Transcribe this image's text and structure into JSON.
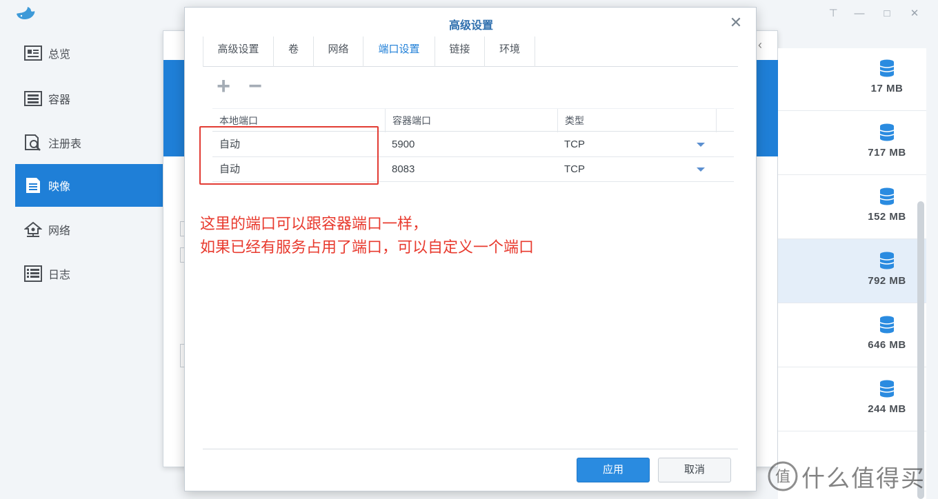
{
  "window": {
    "controls": [
      "pin-icon",
      "minimize-icon",
      "maximize-icon",
      "close-icon"
    ]
  },
  "sidebar": {
    "items": [
      {
        "label": "总览",
        "icon": "overview-icon"
      },
      {
        "label": "容器",
        "icon": "container-icon"
      },
      {
        "label": "注册表",
        "icon": "registry-icon"
      },
      {
        "label": "映像",
        "icon": "image-icon",
        "active": true
      },
      {
        "label": "网络",
        "icon": "network-icon"
      },
      {
        "label": "日志",
        "icon": "log-icon"
      }
    ]
  },
  "image_list": {
    "sizes": [
      "17 MB",
      "717 MB",
      "152 MB",
      "792 MB",
      "646 MB",
      "244 MB"
    ],
    "selected_index": 3
  },
  "dialog": {
    "title": "高级设置",
    "tabs": [
      "高级设置",
      "卷",
      "网络",
      "端口设置",
      "链接",
      "环境"
    ],
    "active_tab": 3,
    "toolbar": {
      "add": "+",
      "remove": "−"
    },
    "table": {
      "headers": [
        "本地端口",
        "容器端口",
        "类型"
      ],
      "rows": [
        {
          "local": "自动",
          "container": "5900",
          "type": "TCP"
        },
        {
          "local": "自动",
          "container": "8083",
          "type": "TCP"
        }
      ]
    },
    "buttons": {
      "apply": "应用",
      "cancel": "取消"
    }
  },
  "annotation": {
    "line1": "这里的端口可以跟容器端口一样，",
    "line2": "如果已经有服务占用了端口，可以自定义一个端口",
    "color": "#e83a2e"
  },
  "watermark": {
    "text": "什么值得买",
    "icon": "zhi-logo"
  },
  "colors": {
    "accent": "#1f7fd7",
    "highlight_box": "#e23b33"
  }
}
